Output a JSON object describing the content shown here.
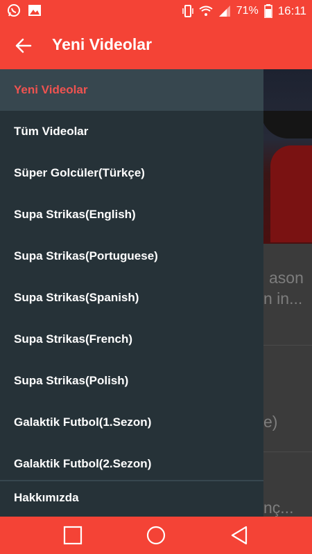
{
  "status_bar": {
    "battery": "71%",
    "time": "16:11"
  },
  "app_bar": {
    "title": "Yeni Videolar"
  },
  "drawer": {
    "items": [
      {
        "label": "Yeni Videolar"
      },
      {
        "label": "Tüm Videolar"
      },
      {
        "label": "Süper Golcüler(Türkçe)"
      },
      {
        "label": "Supa Strikas(English)"
      },
      {
        "label": "Supa Strikas(Portuguese)"
      },
      {
        "label": "Supa Strikas(Spanish)"
      },
      {
        "label": "Supa Strikas(French)"
      },
      {
        "label": "Supa Strikas(Polish)"
      },
      {
        "label": "Galaktik Futbol(1.Sezon)"
      },
      {
        "label": "Galaktik Futbol(2.Sezon)"
      }
    ],
    "footer_item": {
      "label": "Hakkımızda"
    }
  },
  "background": {
    "line1": "ason",
    "line2": "n in...",
    "line3": "e)",
    "line4": "nç..."
  },
  "colors": {
    "accent": "#f44336",
    "drawer_bg": "#263238",
    "drawer_active_bg": "#37474f",
    "active_text": "#ef5350"
  }
}
